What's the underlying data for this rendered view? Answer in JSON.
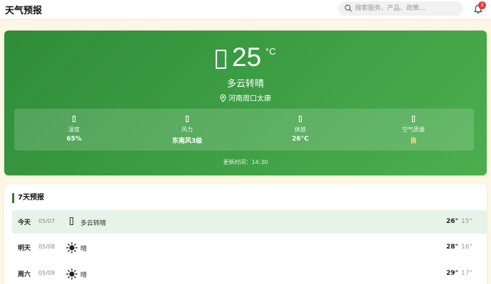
{
  "header": {
    "title": "天气预报",
    "search_placeholder": "搜索服务、产品、政策...",
    "notification_count": "3"
  },
  "current": {
    "icon": "weather-icon",
    "temperature": "25",
    "unit": "°C",
    "condition": "多云转晴",
    "location": "河南周口太康",
    "stats": [
      {
        "label": "湿度",
        "value": "65%"
      },
      {
        "label": "风力",
        "value": "东南风3级"
      },
      {
        "label": "体感",
        "value": "26°C"
      },
      {
        "label": "空气质量",
        "value": "良"
      }
    ],
    "updated": "更新时间：14:30"
  },
  "forecast": {
    "title": "7天预报",
    "days": [
      {
        "day": "今天",
        "date": "05/07",
        "icon": "cloud-sun-icon",
        "condition": "多云转晴",
        "high": "26°",
        "low": "15°"
      },
      {
        "day": "明天",
        "date": "05/08",
        "icon": "sun-icon",
        "condition": "晴",
        "high": "28°",
        "low": "16°"
      },
      {
        "day": "周六",
        "date": "05/09",
        "icon": "sun-icon",
        "condition": "晴",
        "high": "29°",
        "low": "17°"
      }
    ]
  },
  "colors": {
    "hero_start": "#2f8d38",
    "hero_end": "#4cae4f",
    "accent": "#2e7d32",
    "badge": "#e53935",
    "air_quality_good": "#ffe27a"
  }
}
